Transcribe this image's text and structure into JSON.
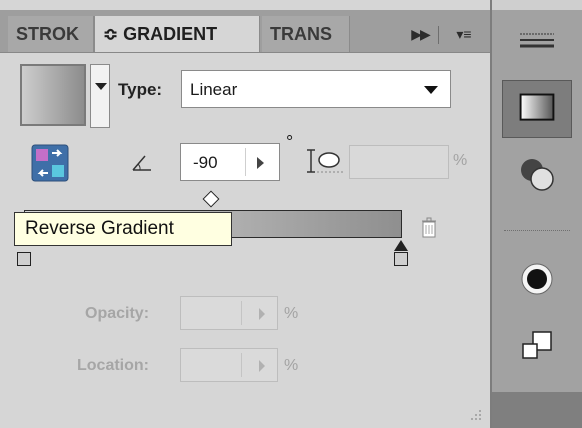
{
  "tabs": [
    {
      "label": "STROK",
      "active": false
    },
    {
      "label": "≎ GRADIENT",
      "active": true
    },
    {
      "label": "TRANS",
      "active": false
    }
  ],
  "tab_controls": {
    "collapse_icon": "double-chevron-right-icon",
    "menu_icon": "panel-menu-icon"
  },
  "type": {
    "label": "Type:",
    "value": "Linear"
  },
  "angle": {
    "value": "-90",
    "unit": "°"
  },
  "aspect_ratio": {
    "value": "",
    "unit": "%"
  },
  "tooltip": "Reverse Gradient",
  "opacity": {
    "label": "Opacity:",
    "value": "",
    "unit": "%"
  },
  "location": {
    "label": "Location:",
    "value": "",
    "unit": "%"
  },
  "gradient": {
    "start_color": "#d6d6d6",
    "end_color": "#8f8f8f"
  },
  "dock": [
    "stroke-panel-icon",
    "gradient-panel-icon",
    "transparency-panel-icon",
    "appearance-panel-icon",
    "graphic-styles-panel-icon"
  ]
}
